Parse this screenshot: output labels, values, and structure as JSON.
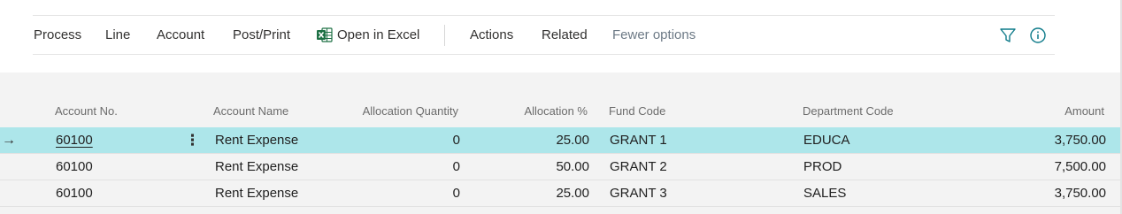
{
  "toolbar": {
    "items": [
      "Process",
      "Line",
      "Account",
      "Post/Print",
      "Open in Excel",
      "Actions",
      "Related",
      "Fewer options"
    ],
    "excel_icon": "excel-icon",
    "filter_icon": "filter-icon",
    "info_icon": "info-icon",
    "icon_color": "#0f7b8a",
    "excel_color": "#1e7145"
  },
  "grid": {
    "columns": [
      "Account No.",
      "Account Name",
      "Allocation Quantity",
      "Allocation %",
      "Fund Code",
      "Department Code",
      "Amount"
    ],
    "selected_row_color": "#ade6ea",
    "rows": [
      {
        "account_no": "60100",
        "account_name": "Rent Expense",
        "allocation_quantity": "0",
        "allocation_pct": "25.00",
        "fund_code": "GRANT 1",
        "department_code": "EDUCA",
        "amount": "3,750.00",
        "selected": true
      },
      {
        "account_no": "60100",
        "account_name": "Rent Expense",
        "allocation_quantity": "0",
        "allocation_pct": "50.00",
        "fund_code": "GRANT 2",
        "department_code": "PROD",
        "amount": "7,500.00",
        "selected": false
      },
      {
        "account_no": "60100",
        "account_name": "Rent Expense",
        "allocation_quantity": "0",
        "allocation_pct": "25.00",
        "fund_code": "GRANT 3",
        "department_code": "SALES",
        "amount": "3,750.00",
        "selected": false
      }
    ],
    "current_row_indicator": "→",
    "row_menu_glyph": "⋮"
  }
}
